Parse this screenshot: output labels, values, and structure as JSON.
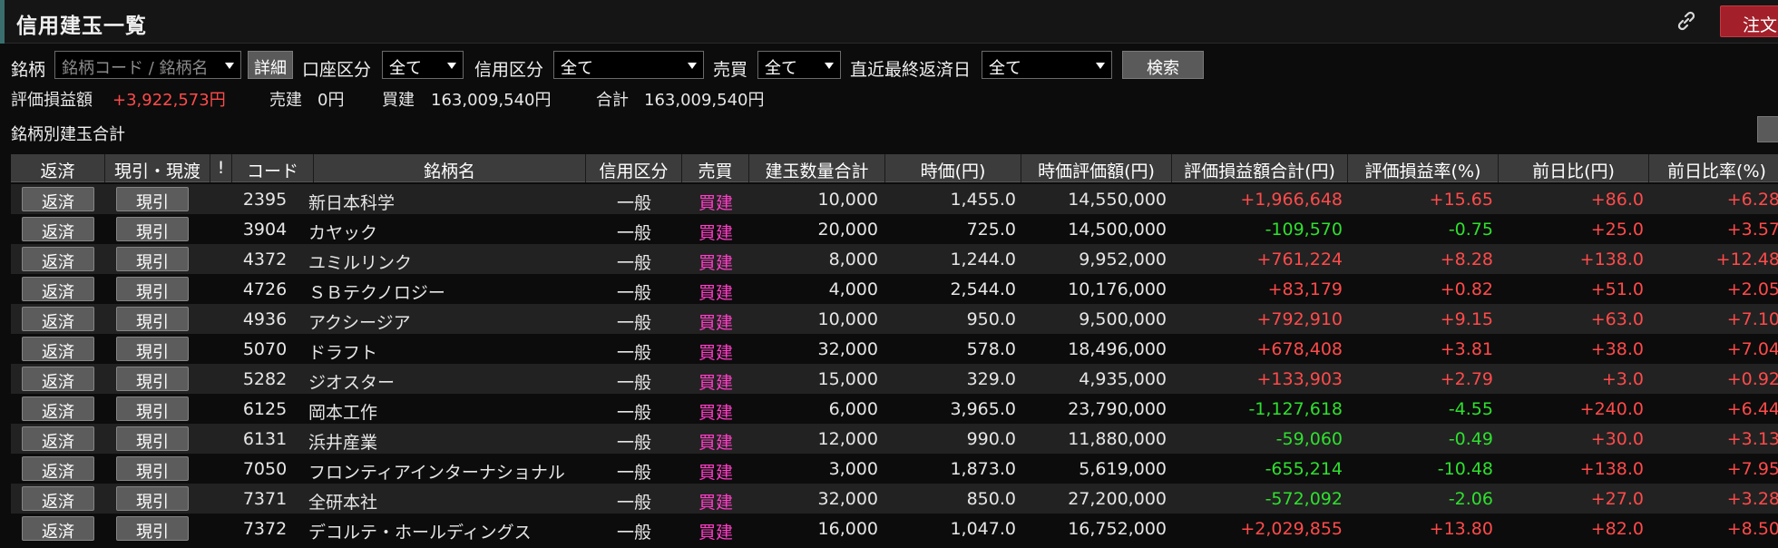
{
  "window": {
    "title": "信用建玉一覧",
    "order_button": "注文"
  },
  "filters": {
    "meigara_label": "銘柄",
    "meigara_placeholder": "銘柄コード / 銘柄名",
    "detail_button": "詳細",
    "account_label": "口座区分",
    "account_value": "全て",
    "credit_label": "信用区分",
    "credit_value": "全て",
    "trade_label": "売買",
    "trade_value": "全て",
    "due_label": "直近最終返済日",
    "due_value": "全て",
    "search_button": "検索"
  },
  "summary": {
    "pl_label": "評価損益額",
    "pl_value": "+3,922,573円",
    "sell_label": "売建",
    "sell_value": "0円",
    "buy_label": "買建",
    "buy_value": "163,009,540円",
    "total_label": "合計",
    "total_value": "163,009,540円"
  },
  "section_label": "銘柄別建玉合計",
  "table": {
    "headers": [
      "返済",
      "現引・現渡",
      "!",
      "コード",
      "銘柄名",
      "信用区分",
      "売買",
      "建玉数量合計",
      "時価(円)",
      "時価評価額(円)",
      "評価損益額合計(円)",
      "評価損益率(%)",
      "前日比(円)",
      "前日比率(%)"
    ],
    "repay_label": "返済",
    "genbiki_label": "現引",
    "rows": [
      {
        "code": "2395",
        "name": "新日本科学",
        "credit": "一般",
        "side": "買建",
        "qty": "10,000",
        "price": "1,455.0",
        "value": "14,550,000",
        "pl": "+1,966,648",
        "pl_rate": "+15.65",
        "chg": "+86.0",
        "chg_rate": "+6.28",
        "pl_sign": "pos",
        "chg_sign": "pos"
      },
      {
        "code": "3904",
        "name": "カヤック",
        "credit": "一般",
        "side": "買建",
        "qty": "20,000",
        "price": "725.0",
        "value": "14,500,000",
        "pl": "-109,570",
        "pl_rate": "-0.75",
        "chg": "+25.0",
        "chg_rate": "+3.57",
        "pl_sign": "neg",
        "chg_sign": "pos"
      },
      {
        "code": "4372",
        "name": "ユミルリンク",
        "credit": "一般",
        "side": "買建",
        "qty": "8,000",
        "price": "1,244.0",
        "value": "9,952,000",
        "pl": "+761,224",
        "pl_rate": "+8.28",
        "chg": "+138.0",
        "chg_rate": "+12.48",
        "pl_sign": "pos",
        "chg_sign": "pos"
      },
      {
        "code": "4726",
        "name": "ＳＢテクノロジー",
        "credit": "一般",
        "side": "買建",
        "qty": "4,000",
        "price": "2,544.0",
        "value": "10,176,000",
        "pl": "+83,179",
        "pl_rate": "+0.82",
        "chg": "+51.0",
        "chg_rate": "+2.05",
        "pl_sign": "pos",
        "chg_sign": "pos"
      },
      {
        "code": "4936",
        "name": "アクシージア",
        "credit": "一般",
        "side": "買建",
        "qty": "10,000",
        "price": "950.0",
        "value": "9,500,000",
        "pl": "+792,910",
        "pl_rate": "+9.15",
        "chg": "+63.0",
        "chg_rate": "+7.10",
        "pl_sign": "pos",
        "chg_sign": "pos"
      },
      {
        "code": "5070",
        "name": "ドラフト",
        "credit": "一般",
        "side": "買建",
        "qty": "32,000",
        "price": "578.0",
        "value": "18,496,000",
        "pl": "+678,408",
        "pl_rate": "+3.81",
        "chg": "+38.0",
        "chg_rate": "+7.04",
        "pl_sign": "pos",
        "chg_sign": "pos"
      },
      {
        "code": "5282",
        "name": "ジオスター",
        "credit": "一般",
        "side": "買建",
        "qty": "15,000",
        "price": "329.0",
        "value": "4,935,000",
        "pl": "+133,903",
        "pl_rate": "+2.79",
        "chg": "+3.0",
        "chg_rate": "+0.92",
        "pl_sign": "pos",
        "chg_sign": "pos"
      },
      {
        "code": "6125",
        "name": "岡本工作",
        "credit": "一般",
        "side": "買建",
        "qty": "6,000",
        "price": "3,965.0",
        "value": "23,790,000",
        "pl": "-1,127,618",
        "pl_rate": "-4.55",
        "chg": "+240.0",
        "chg_rate": "+6.44",
        "pl_sign": "neg",
        "chg_sign": "pos"
      },
      {
        "code": "6131",
        "name": "浜井産業",
        "credit": "一般",
        "side": "買建",
        "qty": "12,000",
        "price": "990.0",
        "value": "11,880,000",
        "pl": "-59,060",
        "pl_rate": "-0.49",
        "chg": "+30.0",
        "chg_rate": "+3.13",
        "pl_sign": "neg",
        "chg_sign": "pos"
      },
      {
        "code": "7050",
        "name": "フロンティアインターナショナル",
        "credit": "一般",
        "side": "買建",
        "qty": "3,000",
        "price": "1,873.0",
        "value": "5,619,000",
        "pl": "-655,214",
        "pl_rate": "-10.48",
        "chg": "+138.0",
        "chg_rate": "+7.95",
        "pl_sign": "neg",
        "chg_sign": "pos"
      },
      {
        "code": "7371",
        "name": "全研本社",
        "credit": "一般",
        "side": "買建",
        "qty": "32,000",
        "price": "850.0",
        "value": "27,200,000",
        "pl": "-572,092",
        "pl_rate": "-2.06",
        "chg": "+27.0",
        "chg_rate": "+3.28",
        "pl_sign": "neg",
        "chg_sign": "pos"
      },
      {
        "code": "7372",
        "name": "デコルテ・ホールディングス",
        "credit": "一般",
        "side": "買建",
        "qty": "16,000",
        "price": "1,047.0",
        "value": "16,752,000",
        "pl": "+2,029,855",
        "pl_rate": "+13.80",
        "chg": "+82.0",
        "chg_rate": "+8.50",
        "pl_sign": "pos",
        "chg_sign": "pos"
      }
    ]
  },
  "colors": {
    "positive": "#ff4a4a",
    "negative": "#2ee02e",
    "side": "#ff3ec8",
    "order_button": "#a3202a"
  },
  "icons": {
    "link": "link-icon",
    "dropdown": "chevron-down-icon"
  }
}
